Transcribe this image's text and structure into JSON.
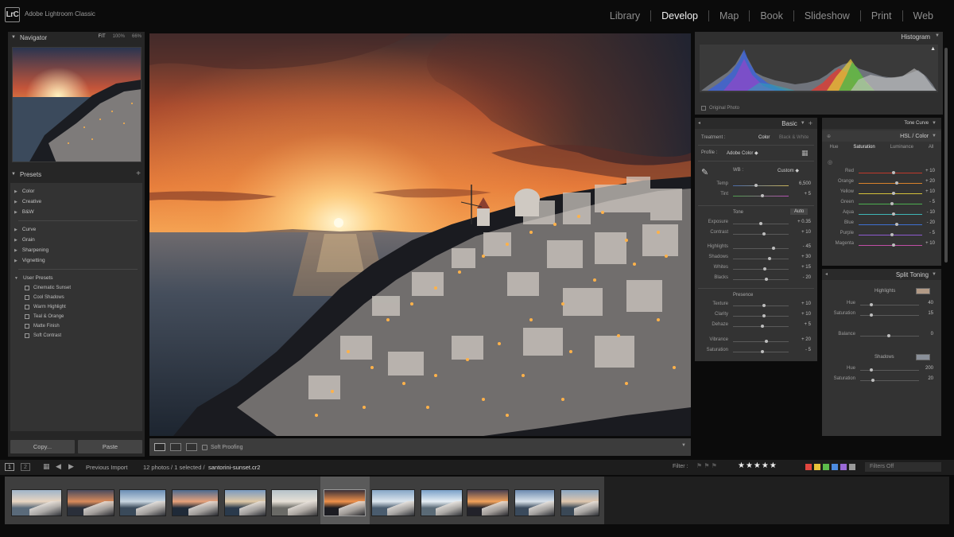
{
  "app": {
    "logo": "LrC",
    "title": "Adobe Lightroom Classic"
  },
  "modules": [
    "Library",
    "Develop",
    "Map",
    "Book",
    "Slideshow",
    "Print",
    "Web"
  ],
  "active_module": "Develop",
  "navigator": {
    "title": "Navigator",
    "options": [
      "FIT",
      "100%",
      "66%"
    ],
    "active_option": "FIT"
  },
  "presets": {
    "title": "Presets",
    "groups_a": [
      "Color",
      "Creative",
      "B&W"
    ],
    "groups_b": [
      "Curve",
      "Grain",
      "Sharpening",
      "Vignetting"
    ],
    "user_group": "User Presets",
    "user_presets": [
      "Cinematic Sunset",
      "Cool Shadows",
      "Warm Highlight",
      "Teal & Orange",
      "Matte Finish",
      "Soft Contrast"
    ]
  },
  "left_buttons": {
    "copy": "Copy...",
    "paste": "Paste"
  },
  "toolbar": {
    "soft_proofing": "Soft Proofing"
  },
  "histogram": {
    "title": "Histogram",
    "original_photo": "Original Photo"
  },
  "basic": {
    "title": "Basic",
    "treatment_label": "Treatment :",
    "treatment_color": "Color",
    "treatment_bw": "Black & White",
    "profile_label": "Profile :",
    "profile_value": "Adobe Color",
    "wb_label": "WB :",
    "wb_value": "Custom",
    "temp": {
      "label": "Temp",
      "value": "6,500"
    },
    "tint": {
      "label": "Tint",
      "value": "+ 5"
    },
    "tone_label": "Tone",
    "auto_label": "Auto",
    "tone": [
      {
        "label": "Exposure",
        "value": "+ 0.35"
      },
      {
        "label": "Contrast",
        "value": "+ 10"
      },
      {
        "label": "Highlights",
        "value": "- 45"
      },
      {
        "label": "Shadows",
        "value": "+ 30"
      },
      {
        "label": "Whites",
        "value": "+ 15"
      },
      {
        "label": "Blacks",
        "value": "- 20"
      }
    ],
    "presence_label": "Presence",
    "presence": [
      {
        "label": "Texture",
        "value": "+ 10"
      },
      {
        "label": "Clarity",
        "value": "+ 10"
      },
      {
        "label": "Dehaze",
        "value": "+ 5"
      },
      {
        "label": "Vibrance",
        "value": "+ 20"
      },
      {
        "label": "Saturation",
        "value": "- 5"
      }
    ]
  },
  "tone_curve": {
    "title": "Tone Curve"
  },
  "hsl": {
    "title": "HSL / Color",
    "tabs": [
      "Hue",
      "Saturation",
      "Luminance",
      "All"
    ],
    "active_tab": "Saturation",
    "rows": [
      {
        "label": "Red",
        "value": "+ 10"
      },
      {
        "label": "Orange",
        "value": "+ 20"
      },
      {
        "label": "Yellow",
        "value": "+ 10"
      },
      {
        "label": "Green",
        "value": "- 5"
      },
      {
        "label": "Aqua",
        "value": "- 10"
      },
      {
        "label": "Blue",
        "value": "- 20"
      },
      {
        "label": "Purple",
        "value": "- 5"
      },
      {
        "label": "Magenta",
        "value": "+ 10"
      }
    ]
  },
  "split": {
    "title": "Split Toning",
    "highlights_label": "Highlights",
    "hi_hue": {
      "label": "Hue",
      "value": "40"
    },
    "hi_sat": {
      "label": "Saturation",
      "value": "15"
    },
    "balance": {
      "label": "Balance",
      "value": "0"
    },
    "shadows_label": "Shadows",
    "sh_hue": {
      "label": "Hue",
      "value": "200"
    },
    "sh_sat": {
      "label": "Saturation",
      "value": "20"
    },
    "highlight_swatch": "#b29a86",
    "shadow_swatch": "#8a9099"
  },
  "filmbar": {
    "pages": [
      "1",
      "2"
    ],
    "source": "Previous Import",
    "count_text": "12 photos / 1 selected /",
    "filename": "santorini-sunset.cr2",
    "filter_label": "Filter :",
    "filters_off": "Filters Off",
    "color_labels": [
      "#e0463f",
      "#e8c33a",
      "#5cbb4b",
      "#4c8be0",
      "#9a6ad6",
      "#9a9a9a"
    ]
  },
  "colors": {
    "accent_active": "#f0f0f0",
    "panel": "#333333"
  }
}
